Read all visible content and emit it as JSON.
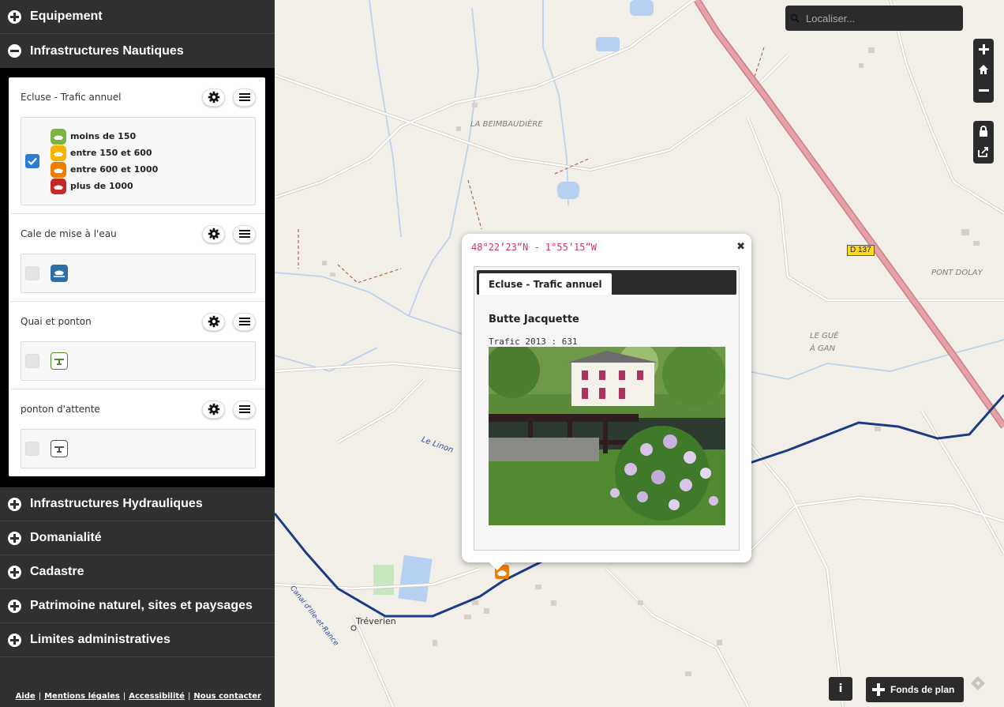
{
  "sidebar": {
    "categories_top": [
      {
        "label": "Equipement",
        "expanded": false
      },
      {
        "label": "Infrastructures Nautiques",
        "expanded": true
      }
    ],
    "layers": [
      {
        "name": "Ecluse - Trafic annuel",
        "checked": true,
        "legend": [
          {
            "label": "moins de 150",
            "color": "#7cb342"
          },
          {
            "label": "entre 150 et 600",
            "color": "#f4b400"
          },
          {
            "label": "entre 600 et 1000",
            "color": "#ef7d00"
          },
          {
            "label": "plus de 1000",
            "color": "#c62828"
          }
        ]
      },
      {
        "name": "Cale de mise à l'eau",
        "checked": false,
        "symbol": "boat-ramp-icon",
        "symbol_color": "#2f6fa6"
      },
      {
        "name": "Quai et ponton",
        "checked": false,
        "symbol": "quay-icon",
        "symbol_color": "#4f8a2b"
      },
      {
        "name": "ponton d'attente",
        "checked": false,
        "symbol": "waiting-pontoon-icon",
        "symbol_color": "#555555"
      }
    ],
    "categories_bottom": [
      {
        "label": "Infrastructures Hydrauliques"
      },
      {
        "label": "Domanialité"
      },
      {
        "label": "Cadastre"
      },
      {
        "label": "Patrimoine naturel, sites et paysages"
      },
      {
        "label": "Limites administratives"
      }
    ],
    "footer": {
      "links": [
        "Aide",
        "Mentions légales",
        "Accessibilité",
        "Nous contacter"
      ]
    }
  },
  "map": {
    "search": {
      "placeholder": "Localiser..."
    },
    "labels": {
      "place1": "LA BEIMBAUDIÈRE",
      "place2": "PONT DOLAY",
      "place3a": "LE GUÉ",
      "place3b": "À GAN",
      "town": "Tréverien",
      "river": "Le Linon",
      "canal": "Canal d'Ille-et-Rance",
      "road": "D 137"
    },
    "controls": {
      "info_label": "i",
      "basemap_label": "Fonds de plan"
    }
  },
  "popup": {
    "coords": "48°22’23”N - 1°55’15”W",
    "tab": "Ecluse - Trafic annuel",
    "feature_name": "Butte Jacquette",
    "traffic": "Trafic 2013 : 631"
  }
}
